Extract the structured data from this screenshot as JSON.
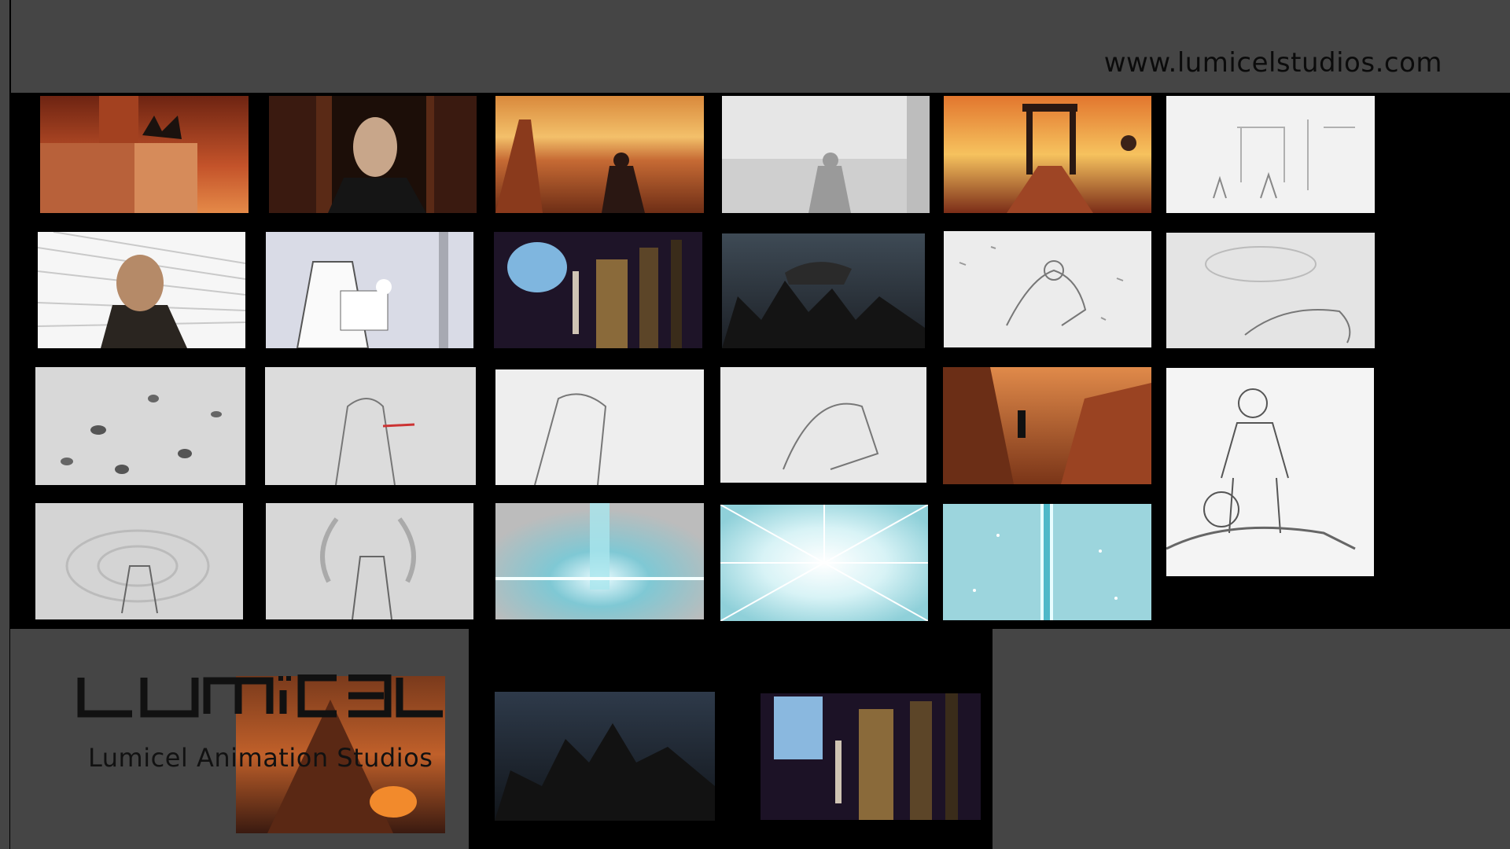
{
  "header": {
    "website": "www.lumicelstudios.com"
  },
  "branding": {
    "logo_text": "LUMICEL",
    "studio_name": "Lumicel Animation Studios",
    "logo_color": "#111111"
  },
  "colors": {
    "background": "#000000",
    "panel_gray": "#454545",
    "sketch_paper": "#e8e8e8",
    "sunset_orange": "#e8823a",
    "magic_cyan": "#9ad6de"
  },
  "storyboard": {
    "frames": [
      {
        "id": 1,
        "style": "color",
        "subject": "city rooftop with gargoyle at sunset"
      },
      {
        "id": 2,
        "style": "color",
        "subject": "masked bald figure in doorway"
      },
      {
        "id": 3,
        "style": "color",
        "subject": "man overlooking sunset city from bridge"
      },
      {
        "id": 4,
        "style": "sketch",
        "subject": "man overlooking city"
      },
      {
        "id": 5,
        "style": "color",
        "subject": "gate with hanging scales at sunset"
      },
      {
        "id": 6,
        "style": "sketch",
        "subject": "street scene with scaffolds"
      },
      {
        "id": 7,
        "style": "color",
        "subject": "bald man with speed lines"
      },
      {
        "id": 8,
        "style": "sketch",
        "subject": "veiled figure holding glowing paper"
      },
      {
        "id": 9,
        "style": "color",
        "subject": "robed figure by columns and round window"
      },
      {
        "id": 10,
        "style": "color",
        "subject": "dark rocky mountain under storm sky"
      },
      {
        "id": 11,
        "style": "sketch",
        "subject": "figure crawling in desert"
      },
      {
        "id": 12,
        "style": "sketch",
        "subject": "figure lying in sand storm"
      },
      {
        "id": 13,
        "style": "sketch",
        "subject": "blowing leaves"
      },
      {
        "id": 14,
        "style": "sketch",
        "subject": "masked figure in wind"
      },
      {
        "id": 15,
        "style": "sketch",
        "subject": "robed figure shielding face"
      },
      {
        "id": 16,
        "style": "sketch",
        "subject": "two figures struggling in wind"
      },
      {
        "id": 17,
        "style": "color",
        "subject": "silhouette in red canyon"
      },
      {
        "id": 18,
        "style": "sketch",
        "subject": "strongman standing over fallen hero"
      },
      {
        "id": 19,
        "style": "sketch",
        "subject": "figure holding bowl in swirl"
      },
      {
        "id": 20,
        "style": "sketch",
        "subject": "smoke rising from hands"
      },
      {
        "id": 21,
        "style": "color",
        "subject": "cyan light beam rising"
      },
      {
        "id": 22,
        "style": "color",
        "subject": "bright burst of light"
      },
      {
        "id": 23,
        "style": "color",
        "subject": "energy beam with sparkles"
      },
      {
        "id": 24,
        "style": "color",
        "subject": "dark mountain landscape"
      },
      {
        "id": 25,
        "style": "color",
        "subject": "hall of columns with window"
      }
    ]
  }
}
